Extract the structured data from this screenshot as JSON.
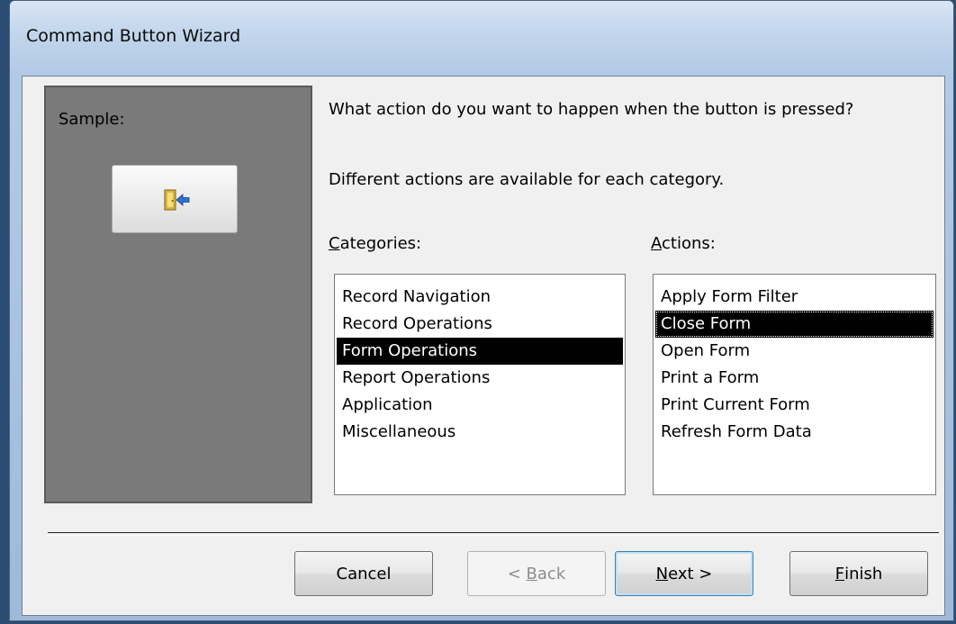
{
  "window": {
    "title": "Command Button Wizard"
  },
  "sample": {
    "label": "Sample:",
    "button_icon": "close-form-door-icon"
  },
  "prompt": {
    "question": "What action do you want to happen when the button is pressed?",
    "note": "Different actions are available for each category."
  },
  "categories": {
    "label_first": "C",
    "label_rest": "ategories:",
    "items": [
      {
        "label": "Record Navigation",
        "selected": false
      },
      {
        "label": "Record Operations",
        "selected": false
      },
      {
        "label": "Form Operations",
        "selected": true
      },
      {
        "label": "Report Operations",
        "selected": false
      },
      {
        "label": "Application",
        "selected": false
      },
      {
        "label": "Miscellaneous",
        "selected": false
      }
    ]
  },
  "actions": {
    "label_first": "A",
    "label_rest": "ctions:",
    "items": [
      {
        "label": "Apply Form Filter",
        "selected": false
      },
      {
        "label": "Close Form",
        "selected": true
      },
      {
        "label": "Open Form",
        "selected": false
      },
      {
        "label": "Print a Form",
        "selected": false
      },
      {
        "label": "Print Current Form",
        "selected": false
      },
      {
        "label": "Refresh Form Data",
        "selected": false
      }
    ]
  },
  "buttons": {
    "cancel": "Cancel",
    "back_prefix": "< ",
    "back_mnem": "B",
    "back_rest": "ack",
    "next_mnem": "N",
    "next_rest": "ext >",
    "finish_mnem": "F",
    "finish_rest": "inish"
  },
  "colors": {
    "selection_bg": "#000000",
    "sample_panel": "#7a7a7a",
    "default_button_border": "#3c7fb1"
  }
}
